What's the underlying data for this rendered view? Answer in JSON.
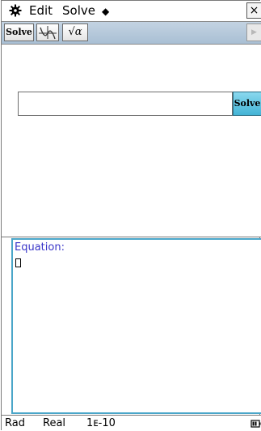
{
  "menubar": {
    "gear_icon": "gear-icon",
    "edit_label": "Edit",
    "solve_label": "Solve",
    "diamond_label": "◆",
    "close_label": "×"
  },
  "toolbar": {
    "solve_label": "Solve",
    "graph_icon": "graph-icon",
    "sqrt_label": "√α",
    "scroll_label": "▶"
  },
  "upper": {
    "equation_value": "",
    "solve_button_label": "Solve"
  },
  "lower": {
    "label": "Equation:",
    "value": ""
  },
  "status": {
    "angle": "Rad",
    "mode": "Real",
    "tolerance": "1ᴇ-10",
    "battery_icon": "battery-icon"
  },
  "colors": {
    "accent_blue": "#4aa6c9",
    "solve_button": "#43b4d6",
    "label_purple": "#3a36c9",
    "toolbar_bg": "#b6c9da"
  }
}
